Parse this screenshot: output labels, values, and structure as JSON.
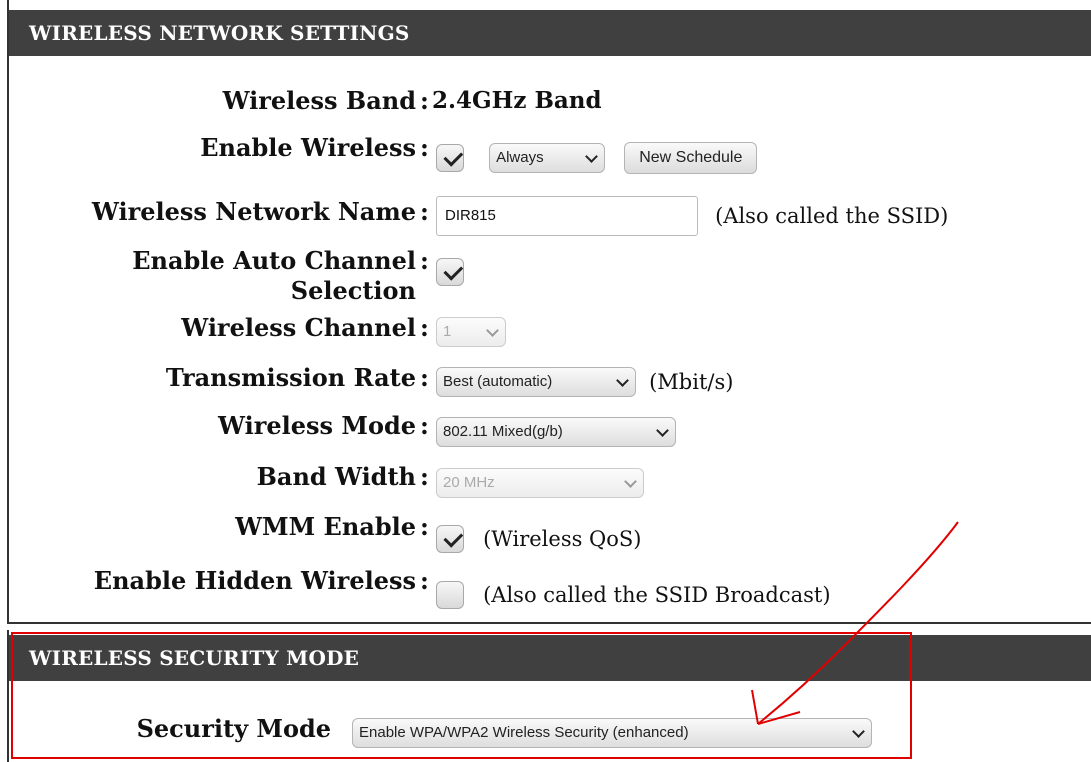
{
  "wireless_settings": {
    "header": "WIRELESS NETWORK SETTINGS",
    "colon": ":",
    "wireless_band": {
      "label": "Wireless Band",
      "value": "2.4GHz Band"
    },
    "enable_wireless": {
      "label": "Enable Wireless",
      "checked": true,
      "schedule": "Always",
      "new_schedule_button": "New Schedule"
    },
    "network_name": {
      "label": "Wireless Network Name",
      "value": "DIR815",
      "note": "(Also called the SSID)"
    },
    "auto_channel": {
      "label": "Enable Auto Channel Selection",
      "checked": true
    },
    "wireless_channel": {
      "label": "Wireless Channel",
      "value": "1",
      "disabled": true
    },
    "transmission_rate": {
      "label": "Transmission Rate",
      "value": "Best (automatic)",
      "unit": "(Mbit/s)"
    },
    "wireless_mode": {
      "label": "Wireless Mode",
      "value": "802.11 Mixed(g/b)"
    },
    "band_width": {
      "label": "Band Width",
      "value": "20 MHz",
      "disabled": true
    },
    "wmm_enable": {
      "label": "WMM Enable",
      "checked": true,
      "note": "(Wireless QoS)"
    },
    "hidden_wireless": {
      "label": "Enable Hidden Wireless",
      "checked": false,
      "note": "(Also called the SSID Broadcast)"
    }
  },
  "security": {
    "header": "WIRELESS SECURITY MODE",
    "security_mode": {
      "label": "Security Mode",
      "value": "Enable WPA/WPA2 Wireless Security (enhanced)"
    }
  },
  "annotation": {
    "color": "#e00000"
  }
}
